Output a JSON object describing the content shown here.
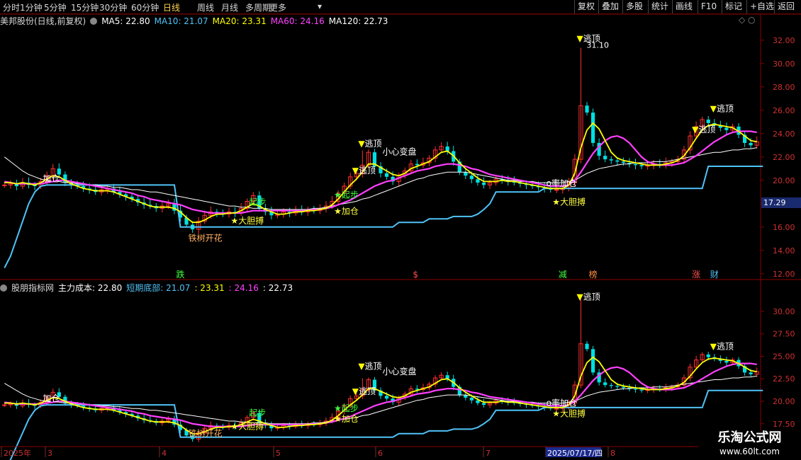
{
  "toolbar": {
    "periods": [
      "分时",
      "1分钟",
      "5分钟",
      "15分钟",
      "30分钟",
      "60分钟",
      "日线",
      "周线",
      "月线",
      "多周期",
      "更多"
    ],
    "active": "日线",
    "more_arrow": "▾",
    "right_buttons": [
      "复权",
      "叠加",
      "多股",
      "统计",
      "画线",
      "F10",
      "+自选",
      "返回"
    ],
    "mark_label": "标记"
  },
  "main_legend": {
    "title": "美邦股份(日线,前复权)",
    "ma5": "MA5: 22.80",
    "ma10": "MA10: 21.07",
    "ma20": "MA20: 23.31",
    "ma60": "MA60: 24.16",
    "ma120": "MA120: 22.73"
  },
  "sub_legend": {
    "title": "股朋指标网",
    "v1": "主力成本: 22.80",
    "v2": "短期底部: 21.07",
    "v3": ": 23.31",
    "v4": ": 24.16",
    "v5": ": 22.73"
  },
  "colors": {
    "ma5": "#ffffff",
    "ma10": "#4fc3f7",
    "ma20": "#ffff00",
    "ma60": "#ff40ff",
    "ma120": "#ffffff",
    "up": "#ff3030",
    "down": "#00e0e0",
    "axis": "#8b0000"
  },
  "current_price": "17.29",
  "watermark": {
    "line1": "乐淘公式网",
    "line2": "www.60lt.com"
  },
  "x_axis": {
    "labels": [
      "2025年",
      "3",
      "4",
      "5",
      "6",
      "7",
      "2025/07/17/四",
      "8"
    ]
  },
  "chart_data": [
    {
      "type": "candlestick",
      "title": "美邦股份(日线,前复权)",
      "ylim": [
        11.5,
        33.2
      ],
      "yticks": [
        12,
        14,
        16,
        18,
        20,
        22,
        24,
        26,
        28,
        30,
        32
      ],
      "ytick_labels": [
        "12.00",
        "14.00",
        "16.00",
        "18.00",
        "20.00",
        "22.00",
        "24.00",
        "26.00",
        "28.00",
        "30.00",
        "32.00"
      ],
      "peak_label": "31.10",
      "close": [
        19.6,
        19.7,
        19.5,
        19.8,
        19.6,
        19.5,
        19.9,
        20.4,
        21.0,
        20.5,
        19.8,
        19.6,
        19.5,
        19.3,
        19.2,
        19.0,
        19.2,
        19.3,
        19.0,
        18.8,
        18.6,
        18.4,
        18.1,
        17.9,
        17.8,
        17.6,
        17.8,
        18.0,
        17.4,
        16.8,
        16.2,
        15.8,
        16.5,
        17.0,
        17.3,
        17.2,
        17.1,
        17.3,
        17.2,
        17.6,
        18.2,
        18.7,
        17.6,
        17.3,
        17.0,
        17.1,
        17.3,
        17.2,
        17.4,
        17.3,
        17.5,
        17.4,
        17.6,
        17.8,
        18.2,
        18.9,
        19.5,
        20.3,
        20.6,
        21.3,
        22.4,
        21.2,
        20.6,
        20.3,
        19.9,
        20.4,
        20.8,
        21.4,
        21.3,
        21.5,
        21.9,
        22.6,
        22.9,
        22.5,
        21.6,
        20.7,
        20.4,
        20.1,
        19.8,
        19.6,
        19.8,
        20.1,
        20.0,
        19.9,
        19.8,
        19.7,
        19.6,
        19.5,
        19.4,
        19.3,
        19.2,
        19.2,
        19.3,
        19.8,
        21.8,
        26.4,
        25.8,
        23.2,
        22.1,
        21.8,
        21.7,
        21.6,
        21.5,
        21.4,
        21.3,
        21.2,
        21.3,
        21.4,
        21.3,
        21.5,
        21.6,
        21.8,
        22.6,
        23.8,
        24.6,
        25.2,
        24.9,
        24.7,
        24.5,
        24.3,
        24.6,
        23.9,
        23.2,
        23.0,
        23.3
      ],
      "ma5": [
        19.8,
        19.8,
        19.7,
        19.8,
        19.7,
        19.6,
        19.8,
        20.1,
        20.4,
        20.3,
        20.0,
        19.7,
        19.5,
        19.3,
        19.2,
        19.1,
        19.1,
        19.1,
        19.0,
        18.8,
        18.6,
        18.4,
        18.2,
        18.0,
        17.8,
        17.7,
        17.7,
        17.7,
        17.6,
        17.3,
        16.8,
        16.4,
        16.4,
        16.6,
        16.9,
        17.1,
        17.1,
        17.2,
        17.2,
        17.4,
        17.7,
        18.0,
        17.8,
        17.5,
        17.3,
        17.1,
        17.1,
        17.2,
        17.3,
        17.3,
        17.4,
        17.4,
        17.5,
        17.6,
        17.9,
        18.4,
        19.0,
        19.6,
        20.1,
        20.7,
        21.4,
        21.4,
        21.1,
        20.8,
        20.5,
        20.4,
        20.6,
        21.0,
        21.2,
        21.4,
        21.6,
        22.0,
        22.4,
        22.5,
        22.1,
        21.5,
        21.0,
        20.6,
        20.2,
        19.9,
        19.9,
        19.9,
        20.0,
        19.9,
        19.9,
        19.8,
        19.7,
        19.6,
        19.5,
        19.4,
        19.3,
        19.3,
        19.3,
        19.6,
        20.6,
        22.8,
        24.3,
        24.9,
        24.4,
        23.4,
        22.4,
        21.9,
        21.7,
        21.6,
        21.5,
        21.4,
        21.3,
        21.3,
        21.3,
        21.4,
        21.5,
        21.7,
        22.1,
        22.8,
        23.6,
        24.3,
        24.7,
        24.8,
        24.7,
        24.6,
        24.5,
        24.2,
        23.8,
        23.4,
        23.3
      ],
      "ma20": [
        19.9,
        19.8,
        19.7,
        19.7,
        19.7,
        19.7,
        19.7,
        19.8,
        19.9,
        20.0,
        20.0,
        19.9,
        19.8,
        19.7,
        19.6,
        19.5,
        19.4,
        19.3,
        19.2,
        19.1,
        19.0,
        18.9,
        18.7,
        18.6,
        18.4,
        18.3,
        18.2,
        18.1,
        18.0,
        17.9,
        17.7,
        17.5,
        17.4,
        17.3,
        17.2,
        17.2,
        17.2,
        17.2,
        17.2,
        17.2,
        17.3,
        17.4,
        17.4,
        17.4,
        17.4,
        17.4,
        17.4,
        17.4,
        17.4,
        17.4,
        17.4,
        17.5,
        17.5,
        17.6,
        17.7,
        17.9,
        18.1,
        18.3,
        18.6,
        18.9,
        19.2,
        19.5,
        19.7,
        19.9,
        20.0,
        20.2,
        20.4,
        20.6,
        20.8,
        20.9,
        21.0,
        21.2,
        21.3,
        21.4,
        21.4,
        21.3,
        21.2,
        21.0,
        20.9,
        20.7,
        20.5,
        20.4,
        20.3,
        20.2,
        20.1,
        20.0,
        19.9,
        19.8,
        19.7,
        19.6,
        19.5,
        19.5,
        19.5,
        19.6,
        20.0,
        20.7,
        21.5,
        22.3,
        22.9,
        23.4,
        23.7,
        23.8,
        23.6,
        23.2,
        22.6,
        22.0,
        21.6,
        21.4,
        21.3,
        21.3,
        21.3,
        21.4,
        21.5,
        21.8,
        22.1,
        22.5,
        22.9,
        23.3,
        23.6,
        23.9,
        24.1,
        24.2,
        24.2,
        24.2,
        24.1
      ],
      "ma120": [
        22.0,
        21.6,
        21.2,
        20.8,
        20.5,
        20.3,
        20.1,
        20.0,
        19.9,
        19.9,
        19.8,
        19.8,
        19.7,
        19.7,
        19.6,
        19.6,
        19.5,
        19.5,
        19.4,
        19.4,
        19.3,
        19.2,
        19.2,
        19.1,
        19.0,
        19.0,
        18.9,
        18.8,
        18.7,
        18.6,
        18.5,
        18.4,
        18.3,
        18.2,
        18.1,
        18.0,
        17.9,
        17.8,
        17.8,
        17.7,
        17.7,
        17.6,
        17.6,
        17.6,
        17.5,
        17.5,
        17.5,
        17.5,
        17.5,
        17.5,
        17.5,
        17.6,
        17.6,
        17.7,
        17.8,
        17.9,
        18.0,
        18.1,
        18.2,
        18.4,
        18.5,
        18.7,
        18.9,
        19.1,
        19.3,
        19.5,
        19.7,
        19.9,
        20.1,
        20.2,
        20.4,
        20.5,
        20.6,
        20.7,
        20.7,
        20.7,
        20.7,
        20.6,
        20.5,
        20.4,
        20.3,
        20.2,
        20.1,
        20.0,
        20.0,
        19.9,
        19.9,
        19.9,
        19.8,
        19.8,
        19.8,
        19.8,
        19.8,
        19.9,
        20.0,
        20.3,
        20.6,
        20.8,
        21.0,
        21.1,
        21.2,
        21.3,
        21.4,
        21.4,
        21.5,
        21.5,
        21.5,
        21.6,
        21.6,
        21.6,
        21.7,
        21.8,
        21.9,
        22.0,
        22.1,
        22.2,
        22.3,
        22.4,
        22.4,
        22.5,
        22.6,
        22.6,
        22.7,
        22.7,
        22.8
      ],
      "support": [
        12.5,
        13.5,
        15.0,
        16.5,
        18.0,
        19.0,
        19.5,
        19.6,
        19.6,
        19.6,
        19.6,
        19.6,
        19.6,
        19.6,
        19.6,
        19.6,
        19.6,
        19.6,
        19.6,
        19.6,
        19.6,
        19.6,
        19.6,
        19.6,
        19.6,
        19.6,
        19.6,
        19.6,
        19.6,
        16.0,
        16.0,
        16.0,
        16.0,
        16.0,
        16.0,
        16.0,
        16.0,
        16.0,
        16.0,
        16.0,
        16.0,
        16.0,
        16.0,
        16.0,
        16.0,
        16.0,
        16.0,
        16.0,
        16.0,
        16.0,
        16.0,
        16.0,
        16.0,
        16.0,
        16.0,
        16.0,
        16.0,
        16.0,
        16.0,
        16.0,
        16.0,
        16.0,
        16.0,
        16.0,
        16.0,
        16.4,
        16.4,
        16.4,
        16.4,
        16.4,
        16.7,
        16.7,
        16.7,
        16.7,
        16.9,
        16.9,
        16.9,
        16.9,
        17.1,
        17.5,
        18.0,
        19.0,
        19.0,
        19.0,
        19.0,
        19.0,
        19.0,
        19.0,
        19.0,
        19.3,
        19.3,
        19.3,
        19.3,
        19.3,
        19.3,
        19.3,
        19.3,
        19.3,
        19.3,
        19.3,
        19.3,
        19.3,
        19.3,
        19.3,
        19.3,
        19.3,
        19.3,
        19.3,
        19.3,
        19.3,
        19.3,
        19.3,
        19.3,
        19.3,
        19.3,
        19.3,
        21.2,
        21.2,
        21.2,
        21.2,
        21.2,
        21.2,
        21.2,
        21.2,
        21.2,
        21.2
      ],
      "annotations": [
        {
          "text": "▼逃顶",
          "i": 95,
          "y": 31.9
        },
        {
          "text": "▼逃顶",
          "i": 59,
          "y": 22.9
        },
        {
          "text": "小心变盘",
          "i": 63,
          "y": 22.2
        },
        {
          "text": "▼逃顶",
          "i": 58,
          "y": 20.6
        },
        {
          "text": "▼逃顶",
          "i": 117,
          "y": 25.9
        },
        {
          "text": "▼逃顶",
          "i": 114,
          "y": 24.1
        },
        {
          "text": "加仓",
          "i": 7,
          "y": 19.9
        },
        {
          "text": "起步",
          "i": 41,
          "y": 17.9
        },
        {
          "text": "★大胆搏",
          "i": 38,
          "y": 16.3
        },
        {
          "text": "★起步",
          "i": 55,
          "y": 18.5
        },
        {
          "text": "★加仓",
          "i": 55,
          "y": 17.1
        },
        {
          "text": "铁树开花",
          "i": 31,
          "y": 14.8
        },
        {
          "text": "o率加仓",
          "i": 90,
          "y": 19.5
        },
        {
          "text": "★大胆搏",
          "i": 91,
          "y": 17.9
        }
      ],
      "event_labels": [
        {
          "text": "跌",
          "i": 29
        },
        {
          "text": "$",
          "i": 68
        },
        {
          "text": "减",
          "i": 92
        },
        {
          "text": "榜",
          "i": 97
        },
        {
          "text": "涨",
          "i": 114
        },
        {
          "text": "财",
          "i": 117
        }
      ]
    },
    {
      "type": "candlestick",
      "title": "股朋指标网",
      "ylim": [
        15.2,
        32.2
      ],
      "yticks": [
        17.5,
        20.0,
        22.5,
        25.0,
        27.5,
        30.0
      ],
      "ytick_labels": [
        "17.50",
        "20.00",
        "22.50",
        "25.00",
        "27.50",
        "30.00"
      ],
      "annotations": [
        {
          "text": "▼逃顶",
          "i": 95,
          "y": 31.3
        },
        {
          "text": "▼逃顶",
          "i": 59,
          "y": 23.6
        },
        {
          "text": "小心变盘",
          "i": 63,
          "y": 23.0
        },
        {
          "text": "▼逃顶",
          "i": 58,
          "y": 20.8
        },
        {
          "text": "▼逃顶",
          "i": 117,
          "y": 25.8
        },
        {
          "text": "加仓",
          "i": 7,
          "y": 20.0
        },
        {
          "text": "起步",
          "i": 41,
          "y": 18.4
        },
        {
          "text": "★大胆搏",
          "i": 38,
          "y": 16.9
        },
        {
          "text": "★起步",
          "i": 55,
          "y": 18.9
        },
        {
          "text": "★加仓",
          "i": 55,
          "y": 17.7
        },
        {
          "text": "铁树开花",
          "i": 31,
          "y": 16.1
        },
        {
          "text": "o率加仓",
          "i": 90,
          "y": 19.5
        },
        {
          "text": "★大胆搏",
          "i": 91,
          "y": 18.3
        }
      ]
    }
  ]
}
